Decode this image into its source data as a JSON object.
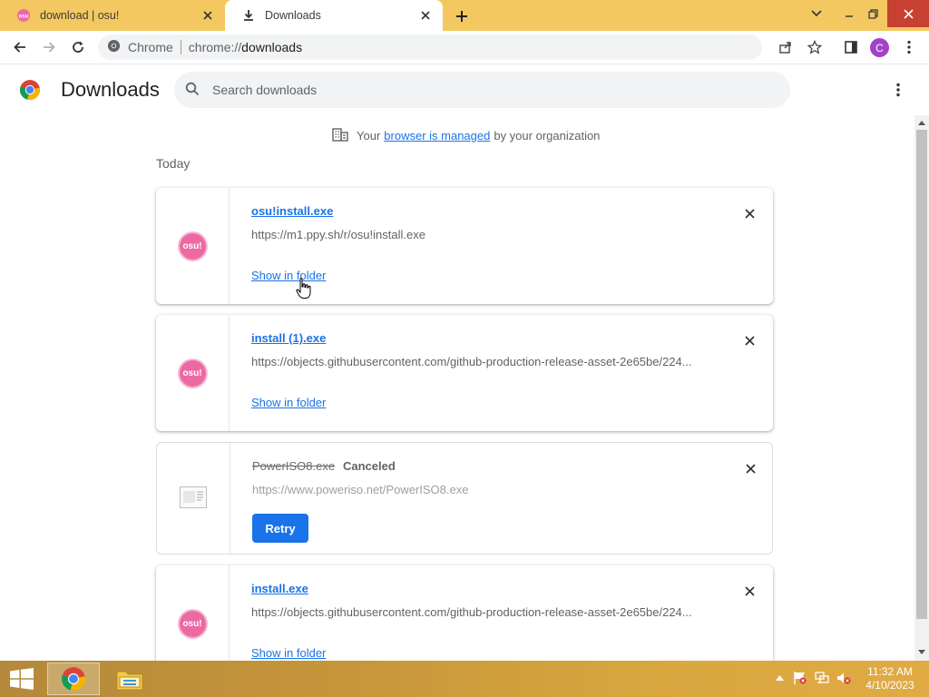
{
  "tabs": [
    {
      "title": "download | osu!",
      "active": false,
      "favicon": "osu-icon"
    },
    {
      "title": "Downloads",
      "active": true,
      "favicon": "download-icon"
    }
  ],
  "toolbar": {
    "site_name": "Chrome",
    "url_scheme": "chrome://",
    "url_host": "downloads",
    "avatar_letter": "C"
  },
  "page": {
    "title": "Downloads",
    "search_placeholder": "Search downloads",
    "managed": {
      "prefix": "Your",
      "link": "browser is managed",
      "suffix": "by your organization"
    },
    "section_label": "Today"
  },
  "downloads": [
    {
      "file_name": "osu!install.exe",
      "url": "https://m1.ppy.sh/r/osu!install.exe",
      "action": "Show in folder",
      "icon": "osu-logo",
      "icon_text": "osu!",
      "status": ""
    },
    {
      "file_name": "install (1).exe",
      "url": "https://objects.githubusercontent.com/github-production-release-asset-2e65be/224...",
      "action": "Show in folder",
      "icon": "osu-logo",
      "icon_text": "osu!",
      "status": ""
    },
    {
      "file_name": "PowerISO8.exe",
      "url": "https://www.poweriso.net/PowerISO8.exe",
      "action": "Retry",
      "icon": "generic-file-icon",
      "status": "Canceled"
    },
    {
      "file_name": "install.exe",
      "url": "https://objects.githubusercontent.com/github-production-release-asset-2e65be/224...",
      "action": "Show in folder",
      "icon": "osu-logo",
      "icon_text": "osu!",
      "status": ""
    }
  ],
  "taskbar": {
    "time": "11:32 AM",
    "date": "4/10/2023"
  },
  "colors": {
    "accent": "#1a73e8",
    "frame": "#f4c861",
    "osu_pink": "#ec6aa3"
  }
}
